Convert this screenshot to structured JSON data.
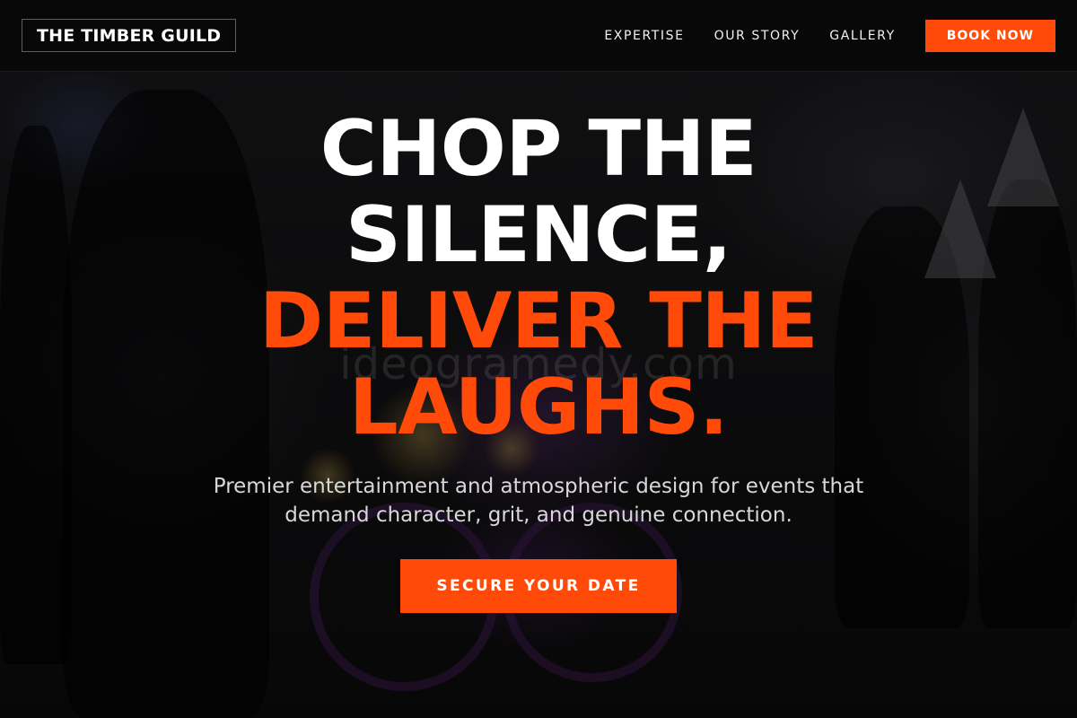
{
  "brand": {
    "name": "THE TIMBER GUILD"
  },
  "nav": {
    "links": [
      {
        "label": "EXPERTISE"
      },
      {
        "label": "OUR STORY"
      },
      {
        "label": "GALLERY"
      }
    ],
    "cta_label": "BOOK NOW"
  },
  "hero": {
    "headline_line1": "CHOP THE",
    "headline_line2": "SILENCE,",
    "headline_line3": "DELIVER THE",
    "headline_line4": "LAUGHS.",
    "subtitle": "Premier entertainment and atmospheric design for events that demand character, grit, and genuine connection.",
    "cta_label": "SECURE YOUR DATE",
    "background_image": "night street scene with people and motorcycle"
  },
  "colors": {
    "accent": "#ff4a0a",
    "header_bg": "#080809",
    "text_primary": "#ffffff",
    "text_secondary": "#d8d8d8"
  }
}
